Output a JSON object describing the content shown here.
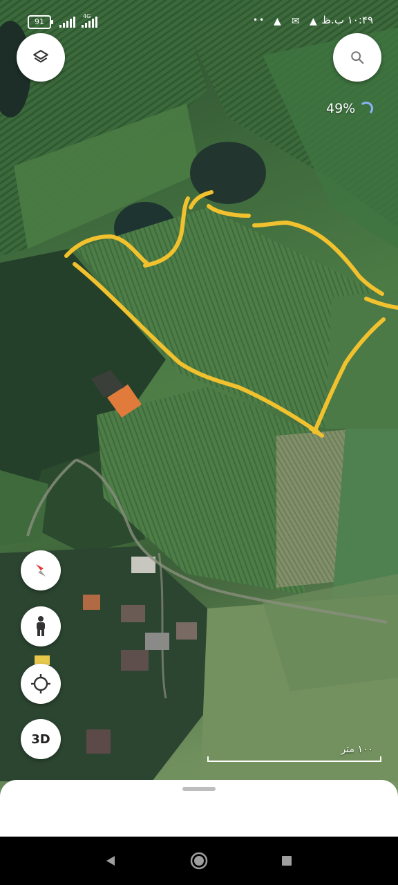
{
  "status_bar": {
    "battery": "91",
    "network": "4G",
    "time": "۱۰:۴۹ ب.ظ",
    "notification_dots": "••"
  },
  "map": {
    "zoom_percent": "49%",
    "scale_label": "۱۰۰ متر",
    "outline_color": "#f2c12e"
  },
  "buttons": {
    "layers_icon": "layers-icon",
    "search_icon": "search-icon",
    "compass_icon": "compass-icon",
    "street_view_icon": "pegman-icon",
    "location_icon": "my-location-icon",
    "three_d_label": "3D"
  },
  "nav": {
    "back_icon": "back-icon",
    "home_icon": "home-icon",
    "recents_icon": "recents-icon"
  }
}
